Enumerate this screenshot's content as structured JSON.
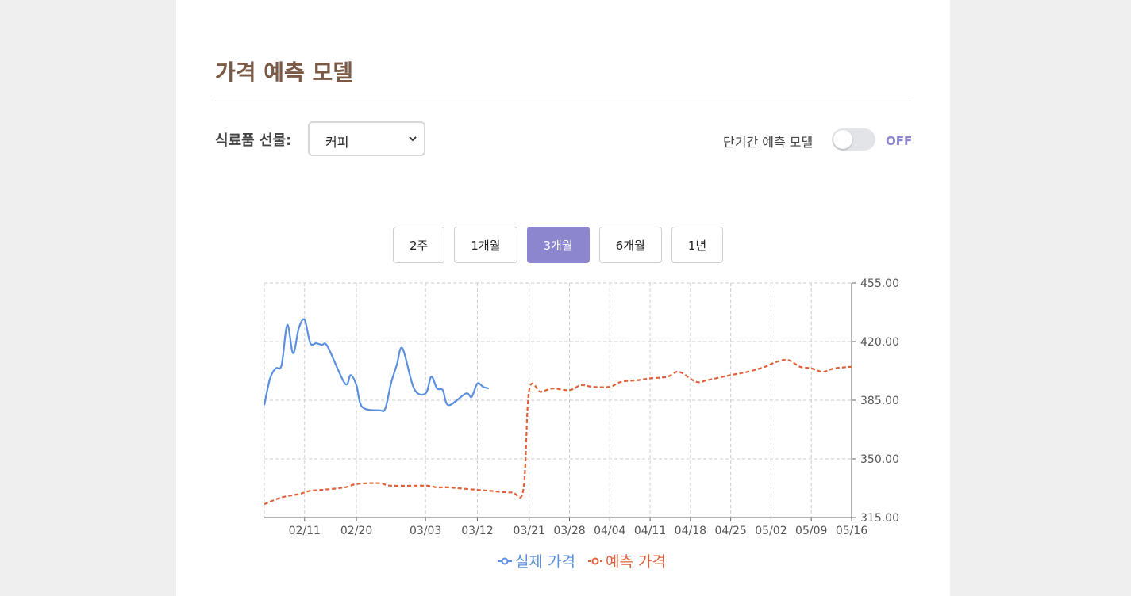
{
  "header": {
    "title": "가격 예측 모델"
  },
  "controls": {
    "commodity_label": "식료품 선물:",
    "commodity_value": "커피",
    "toggle_label": "단기간 예측 모델",
    "toggle_state": "OFF"
  },
  "range_buttons": [
    {
      "label": "2주",
      "active": false
    },
    {
      "label": "1개월",
      "active": false
    },
    {
      "label": "3개월",
      "active": true
    },
    {
      "label": "6개월",
      "active": false
    },
    {
      "label": "1년",
      "active": false
    }
  ],
  "colors": {
    "actual": "#5b8fe0",
    "forecast": "#e0603a",
    "accent": "#8c86cf",
    "title": "#7a5a45"
  },
  "chart_data": {
    "type": "line",
    "x_start": "02/04",
    "x_end": "05/16",
    "x_ticks": [
      "02/11",
      "02/20",
      "03/03",
      "03/12",
      "03/21",
      "03/28",
      "04/04",
      "04/11",
      "04/18",
      "04/25",
      "05/02",
      "05/09",
      "05/16"
    ],
    "y_ticks": [
      "455.00",
      "420.00",
      "385.00",
      "350.00",
      "315.00"
    ],
    "ylim": [
      315,
      455
    ],
    "grid": true,
    "legend_position": "bottom",
    "series": [
      {
        "name": "실제 가격",
        "style": "solid",
        "points": [
          [
            "02/04",
            382
          ],
          [
            "02/05",
            398
          ],
          [
            "02/06",
            404
          ],
          [
            "02/07",
            406
          ],
          [
            "02/08",
            430
          ],
          [
            "02/09",
            413
          ],
          [
            "02/10",
            428
          ],
          [
            "02/11",
            433
          ],
          [
            "02/12",
            419
          ],
          [
            "02/13",
            419
          ],
          [
            "02/14",
            418
          ],
          [
            "02/15",
            417
          ],
          [
            "02/18",
            395
          ],
          [
            "02/19",
            400
          ],
          [
            "02/20",
            394
          ],
          [
            "02/21",
            381
          ],
          [
            "02/24",
            379
          ],
          [
            "02/25",
            380
          ],
          [
            "02/26",
            395
          ],
          [
            "02/27",
            406
          ],
          [
            "02/28",
            416
          ],
          [
            "03/01",
            392
          ],
          [
            "03/03",
            389
          ],
          [
            "03/04",
            399
          ],
          [
            "03/05",
            392
          ],
          [
            "03/06",
            391
          ],
          [
            "03/07",
            382
          ],
          [
            "03/10",
            389
          ],
          [
            "03/11",
            387
          ],
          [
            "03/12",
            395
          ],
          [
            "03/13",
            393
          ],
          [
            "03/14",
            392
          ]
        ]
      },
      {
        "name": "예측 가격",
        "style": "dashed",
        "points": [
          [
            "02/04",
            323
          ],
          [
            "02/07",
            327
          ],
          [
            "02/10",
            329
          ],
          [
            "02/12",
            331
          ],
          [
            "02/14",
            331.5
          ],
          [
            "02/18",
            333
          ],
          [
            "02/20",
            335
          ],
          [
            "02/24",
            335.5
          ],
          [
            "02/26",
            334
          ],
          [
            "03/03",
            334
          ],
          [
            "03/05",
            333
          ],
          [
            "03/07",
            333
          ],
          [
            "03/12",
            331.5
          ],
          [
            "03/14",
            331
          ],
          [
            "03/18",
            330
          ],
          [
            "03/20",
            332
          ],
          [
            "03/21",
            391
          ],
          [
            "03/23",
            390
          ],
          [
            "03/25",
            392
          ],
          [
            "03/28",
            391
          ],
          [
            "03/30",
            394
          ],
          [
            "04/01",
            393
          ],
          [
            "04/04",
            393
          ],
          [
            "04/06",
            396
          ],
          [
            "04/09",
            397
          ],
          [
            "04/11",
            398
          ],
          [
            "04/14",
            399
          ],
          [
            "04/16",
            402
          ],
          [
            "04/19",
            396
          ],
          [
            "04/21",
            397
          ],
          [
            "04/25",
            400
          ],
          [
            "04/28",
            402
          ],
          [
            "05/01",
            405
          ],
          [
            "05/03",
            408
          ],
          [
            "05/05",
            409
          ],
          [
            "05/07",
            405
          ],
          [
            "05/09",
            404
          ],
          [
            "05/11",
            402
          ],
          [
            "05/13",
            404
          ],
          [
            "05/16",
            405
          ]
        ]
      }
    ]
  }
}
